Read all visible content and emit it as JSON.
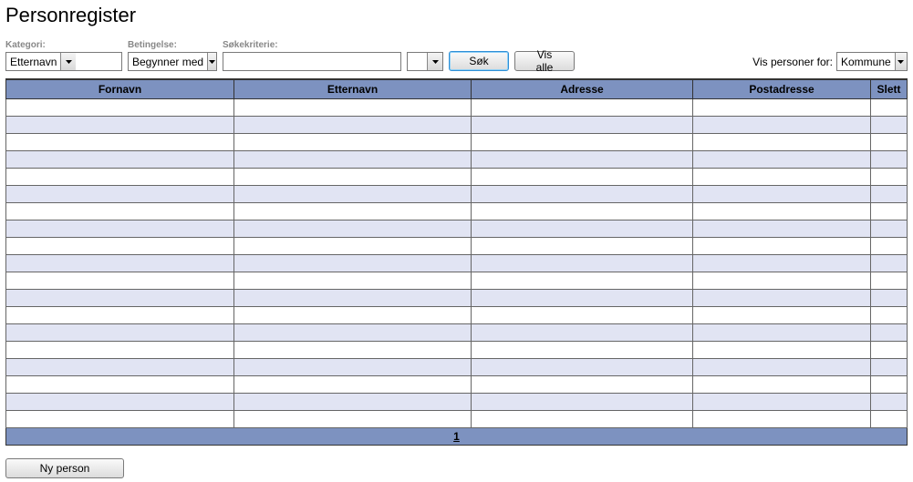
{
  "page": {
    "title": "Personregister"
  },
  "search": {
    "kategori_label": "Kategori:",
    "kategori_value": "Etternavn",
    "betingelse_label": "Betingelse:",
    "betingelse_value": "Begynner med",
    "kriterie_label": "Søkekriterie:",
    "kriterie_value": "",
    "extra_select_value": "",
    "search_button": "Søk",
    "show_all_button": "Vis alle"
  },
  "filter": {
    "label": "Vis personer for:",
    "value": "Kommune"
  },
  "table": {
    "columns": {
      "fornavn": "Fornavn",
      "etternavn": "Etternavn",
      "adresse": "Adresse",
      "postadresse": "Postadresse",
      "slett": "Slett"
    },
    "rows": [
      {
        "fornavn": "",
        "etternavn": "",
        "adresse": "",
        "postadresse": "",
        "slett": ""
      },
      {
        "fornavn": "",
        "etternavn": "",
        "adresse": "",
        "postadresse": "",
        "slett": ""
      },
      {
        "fornavn": "",
        "etternavn": "",
        "adresse": "",
        "postadresse": "",
        "slett": ""
      },
      {
        "fornavn": "",
        "etternavn": "",
        "adresse": "",
        "postadresse": "",
        "slett": ""
      },
      {
        "fornavn": "",
        "etternavn": "",
        "adresse": "",
        "postadresse": "",
        "slett": ""
      },
      {
        "fornavn": "",
        "etternavn": "",
        "adresse": "",
        "postadresse": "",
        "slett": ""
      },
      {
        "fornavn": "",
        "etternavn": "",
        "adresse": "",
        "postadresse": "",
        "slett": ""
      },
      {
        "fornavn": "",
        "etternavn": "",
        "adresse": "",
        "postadresse": "",
        "slett": ""
      },
      {
        "fornavn": "",
        "etternavn": "",
        "adresse": "",
        "postadresse": "",
        "slett": ""
      },
      {
        "fornavn": "",
        "etternavn": "",
        "adresse": "",
        "postadresse": "",
        "slett": ""
      },
      {
        "fornavn": "",
        "etternavn": "",
        "adresse": "",
        "postadresse": "",
        "slett": ""
      },
      {
        "fornavn": "",
        "etternavn": "",
        "adresse": "",
        "postadresse": "",
        "slett": ""
      },
      {
        "fornavn": "",
        "etternavn": "",
        "adresse": "",
        "postadresse": "",
        "slett": ""
      },
      {
        "fornavn": "",
        "etternavn": "",
        "adresse": "",
        "postadresse": "",
        "slett": ""
      },
      {
        "fornavn": "",
        "etternavn": "",
        "adresse": "",
        "postadresse": "",
        "slett": ""
      },
      {
        "fornavn": "",
        "etternavn": "",
        "adresse": "",
        "postadresse": "",
        "slett": ""
      },
      {
        "fornavn": "",
        "etternavn": "",
        "adresse": "",
        "postadresse": "",
        "slett": ""
      },
      {
        "fornavn": "",
        "etternavn": "",
        "adresse": "",
        "postadresse": "",
        "slett": ""
      },
      {
        "fornavn": "",
        "etternavn": "",
        "adresse": "",
        "postadresse": "",
        "slett": ""
      }
    ],
    "page_number": "1"
  },
  "actions": {
    "new_person": "Ny person"
  }
}
